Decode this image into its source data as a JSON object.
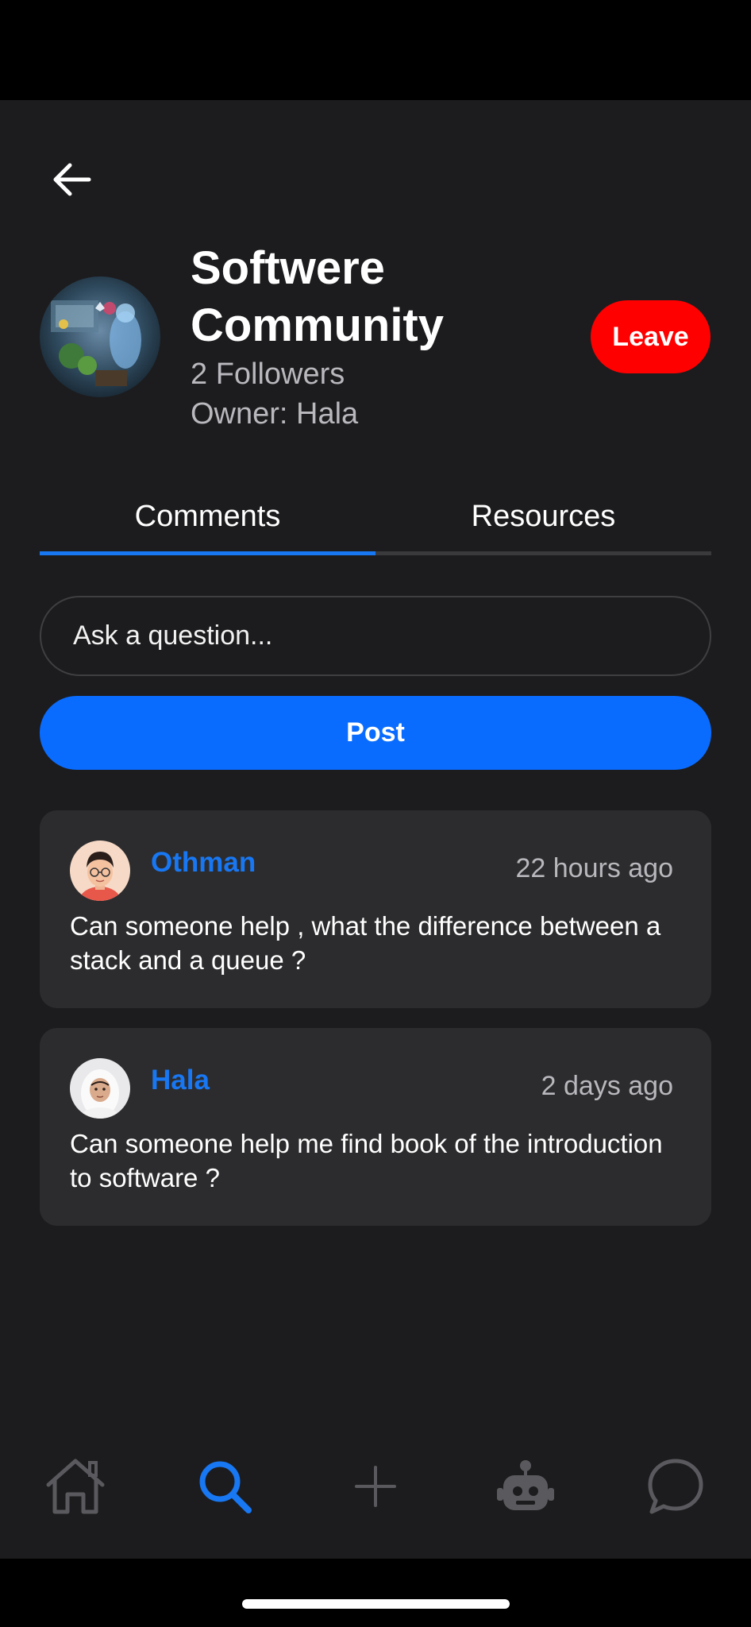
{
  "group": {
    "title_line1": "Softwere",
    "title_line2": "Community",
    "followers": "2 Followers",
    "owner": "Owner: Hala",
    "leave_label": "Leave"
  },
  "tabs": [
    {
      "label": "Comments",
      "active": true
    },
    {
      "label": "Resources",
      "active": false
    }
  ],
  "compose": {
    "placeholder": "Ask a question...",
    "post_label": "Post"
  },
  "comments": [
    {
      "author": "Othman",
      "time": "22 hours ago",
      "text": "Can someone help , what the difference between a stack and a queue ?"
    },
    {
      "author": "Hala",
      "time": "2 days ago",
      "text": "Can someone help me find book of the introduction to software ?"
    }
  ],
  "nav": {
    "items": [
      "home-icon",
      "search-icon",
      "add-icon",
      "bot-icon",
      "chat-icon"
    ],
    "active": "search-icon"
  },
  "colors": {
    "accent": "#1877f2",
    "post_button": "#0a6cff",
    "leave_button": "#ff0000",
    "background": "#1c1c1e",
    "card": "#2c2c2e"
  }
}
